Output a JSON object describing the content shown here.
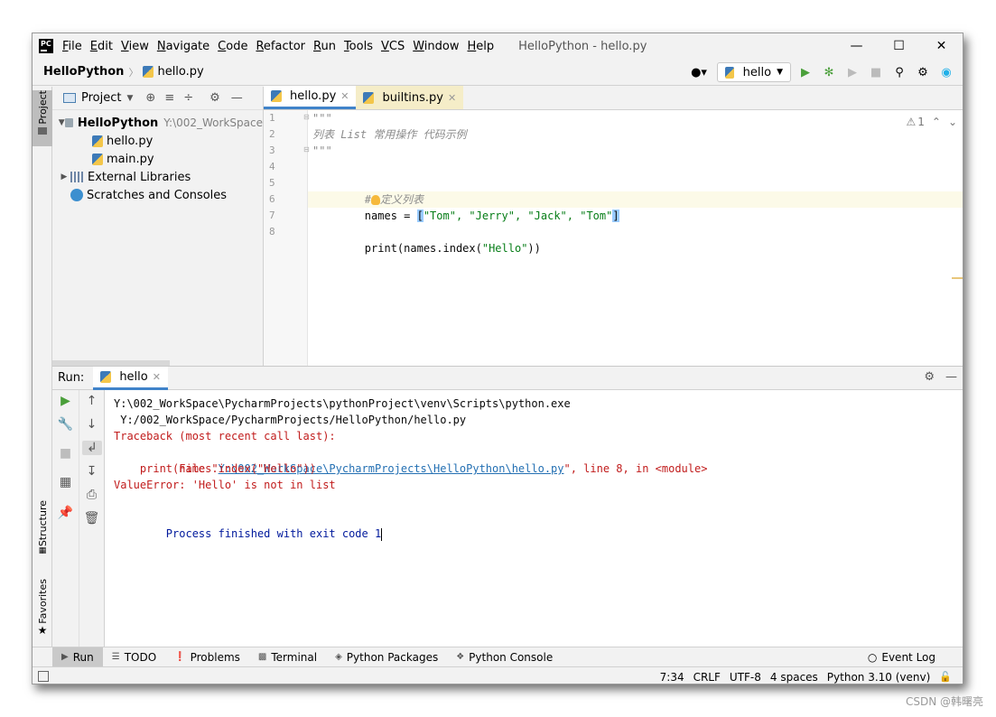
{
  "menu": {
    "logo": "PC",
    "items": [
      "File",
      "Edit",
      "View",
      "Navigate",
      "Code",
      "Refactor",
      "Run",
      "Tools",
      "VCS",
      "Window",
      "Help"
    ],
    "window_title": "HelloPython - hello.py",
    "minimize": "—",
    "maximize": "☐",
    "close": "✕"
  },
  "navbar": {
    "project": "HelloPython",
    "file": "hello.py",
    "run_config": "hello"
  },
  "project_panel": {
    "title": "Project",
    "root": "HelloPython",
    "root_path": "Y:\\002_WorkSpace",
    "files": [
      "hello.py",
      "main.py"
    ],
    "external": "External Libraries",
    "scratches": "Scratches and Consoles"
  },
  "left_strip": {
    "project": "Project",
    "structure": "Structure",
    "favorites": "Favorites"
  },
  "editor": {
    "tabs": [
      {
        "label": "hello.py"
      },
      {
        "label": "builtins.py"
      }
    ],
    "line_numbers": [
      "1",
      "2",
      "3",
      "4",
      "5",
      "6",
      "7",
      "8"
    ],
    "lines": {
      "l1": "\"\"\"",
      "l2": "列表 List 常用操作 代码示例",
      "l3": "\"\"\"",
      "l5_hash": "#",
      "l5_text": "定义列表",
      "l6_a": "names = ",
      "l6_open": "[",
      "l6_items": "\"Tom\", \"Jerry\", \"Jack\", \"Tom\"",
      "l6_close": "]",
      "l8_a": "print(names.index(",
      "l8_str": "\"Hello\"",
      "l8_b": "))"
    },
    "warnings": "1"
  },
  "run_panel": {
    "label": "Run:",
    "tab": "hello",
    "console": {
      "c1": "Y:\\002_WorkSpace\\PycharmProjects\\pythonProject\\venv\\Scripts\\python.exe",
      "c2": " Y:/002_WorkSpace/PycharmProjects/HelloPython/hello.py",
      "c3": "Traceback (most recent call last):",
      "c4_pre": "  File \"",
      "c4_link": "Y:\\002_WorkSpace\\PycharmProjects\\HelloPython\\hello.py",
      "c4_post": "\", line 8, in <module>",
      "c5": "    print(names.index(\"Hello\"))",
      "c6": "ValueError: 'Hello' is not in list",
      "c8": "Process finished with exit code 1"
    }
  },
  "bottom_bar": {
    "run": "Run",
    "todo": "TODO",
    "problems": "Problems",
    "terminal": "Terminal",
    "packages": "Python Packages",
    "console": "Python Console",
    "event_log": "Event Log"
  },
  "status_bar": {
    "position": "7:34",
    "line_sep": "CRLF",
    "encoding": "UTF-8",
    "indent": "4 spaces",
    "interpreter": "Python 3.10 (venv)"
  },
  "watermark": "CSDN @韩曙亮"
}
